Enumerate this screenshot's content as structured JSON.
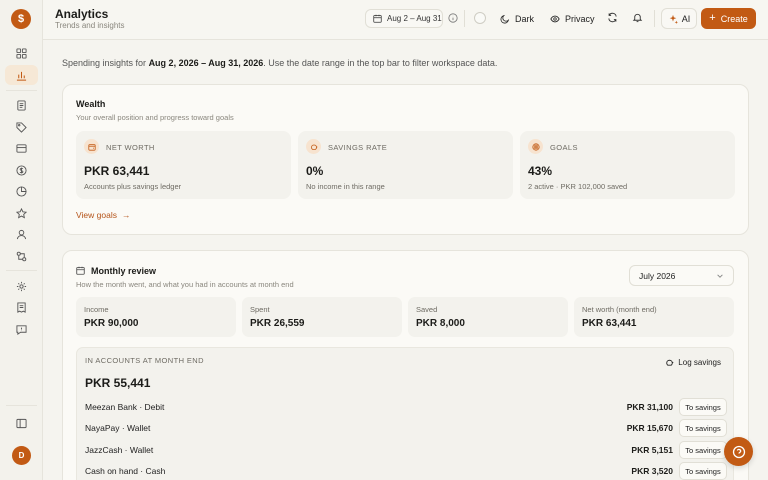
{
  "app": {
    "logo_glyph": "$",
    "accent": "#c25a14"
  },
  "sidebar": {
    "items": [
      {
        "name": "dashboard-icon"
      },
      {
        "name": "analytics-icon",
        "active": true
      },
      {
        "name": "transactions-icon"
      },
      {
        "name": "tag-icon"
      },
      {
        "name": "inbox-icon"
      },
      {
        "name": "dollar-icon"
      },
      {
        "name": "pie-icon"
      },
      {
        "name": "star-icon"
      },
      {
        "name": "user-icon"
      },
      {
        "name": "recurring-icon"
      },
      {
        "name": "settings-icon"
      },
      {
        "name": "receipt-icon"
      },
      {
        "name": "feedback-icon"
      }
    ],
    "avatar_initial": "D"
  },
  "header": {
    "title": "Analytics",
    "subtitle": "Trends and insights",
    "date_range": "Aug 2 – Aug 31",
    "dark_label": "Dark",
    "privacy_label": "Privacy",
    "ai_label": "AI",
    "create_label": "Create"
  },
  "intro": {
    "prefix": "Spending insights for ",
    "range": "Aug 2, 2026 – Aug 31, 2026",
    "suffix": ". Use the date range in the top bar to filter workspace data."
  },
  "wealth": {
    "title": "Wealth",
    "subtitle": "Your overall position and progress toward goals",
    "stats": [
      {
        "label": "NET WORTH",
        "value": "PKR 63,441",
        "sub": "Accounts plus savings ledger",
        "icon": "wallet-icon"
      },
      {
        "label": "SAVINGS RATE",
        "value": "0%",
        "sub": "No income in this range",
        "icon": "piggy-bank-icon"
      },
      {
        "label": "GOALS",
        "value": "43%",
        "sub": "2 active · PKR 102,000 saved",
        "icon": "target-icon"
      }
    ],
    "view_goals": "View goals"
  },
  "monthly": {
    "title": "Monthly review",
    "subtitle": "How the month went, and what you had in accounts at month end",
    "month": "July 2026",
    "summary": [
      {
        "label": "Income",
        "value": "PKR 90,000"
      },
      {
        "label": "Spent",
        "value": "PKR 26,559"
      },
      {
        "label": "Saved",
        "value": "PKR 8,000"
      },
      {
        "label": "Net worth (month end)",
        "value": "PKR 63,441"
      }
    ],
    "accounts_heading": "IN ACCOUNTS AT MONTH END",
    "log_savings": "Log savings",
    "accounts_total": "PKR 55,441",
    "to_savings_label": "To savings",
    "accounts": [
      {
        "name": "Meezan Bank · Debit",
        "amount": "PKR 31,100"
      },
      {
        "name": "NayaPay · Wallet",
        "amount": "PKR 15,670"
      },
      {
        "name": "JazzCash · Wallet",
        "amount": "PKR 5,151"
      },
      {
        "name": "Cash on hand · Cash",
        "amount": "PKR 3,520"
      }
    ]
  }
}
